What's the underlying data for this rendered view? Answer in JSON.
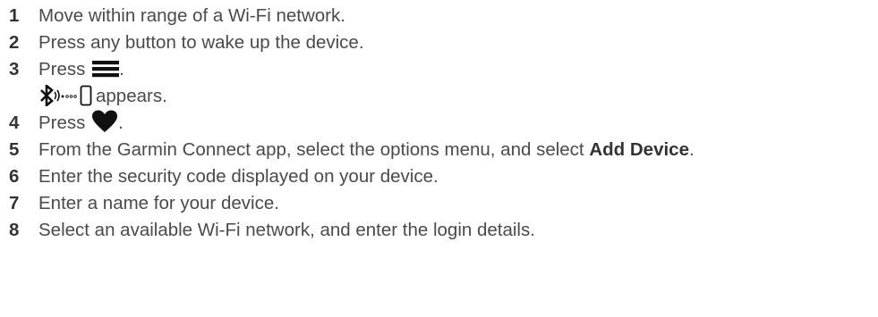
{
  "steps": [
    {
      "num": "1",
      "text": "Move within range of a Wi-Fi network."
    },
    {
      "num": "2",
      "text": "Press any button to wake up the device."
    },
    {
      "num": "3",
      "text_before": "Press",
      "icon": "menu-bars-icon",
      "text_after": "."
    },
    {
      "continuation": true,
      "icons": [
        "bluetooth-pairing-icon",
        "phone-icon"
      ],
      "text": "appears."
    },
    {
      "num": "4",
      "text_before": "Press",
      "icon": "heart-icon",
      "text_after": "."
    },
    {
      "num": "5",
      "text_before": "From the Garmin Connect app, select the options menu, and select",
      "bold": "Add Device",
      "text_after": "."
    },
    {
      "num": "6",
      "text": "Enter the security code displayed on your device."
    },
    {
      "num": "7",
      "text": "Enter a name for your device."
    },
    {
      "num": "8",
      "text": "Select an available Wi-Fi network, and enter the login details."
    }
  ]
}
